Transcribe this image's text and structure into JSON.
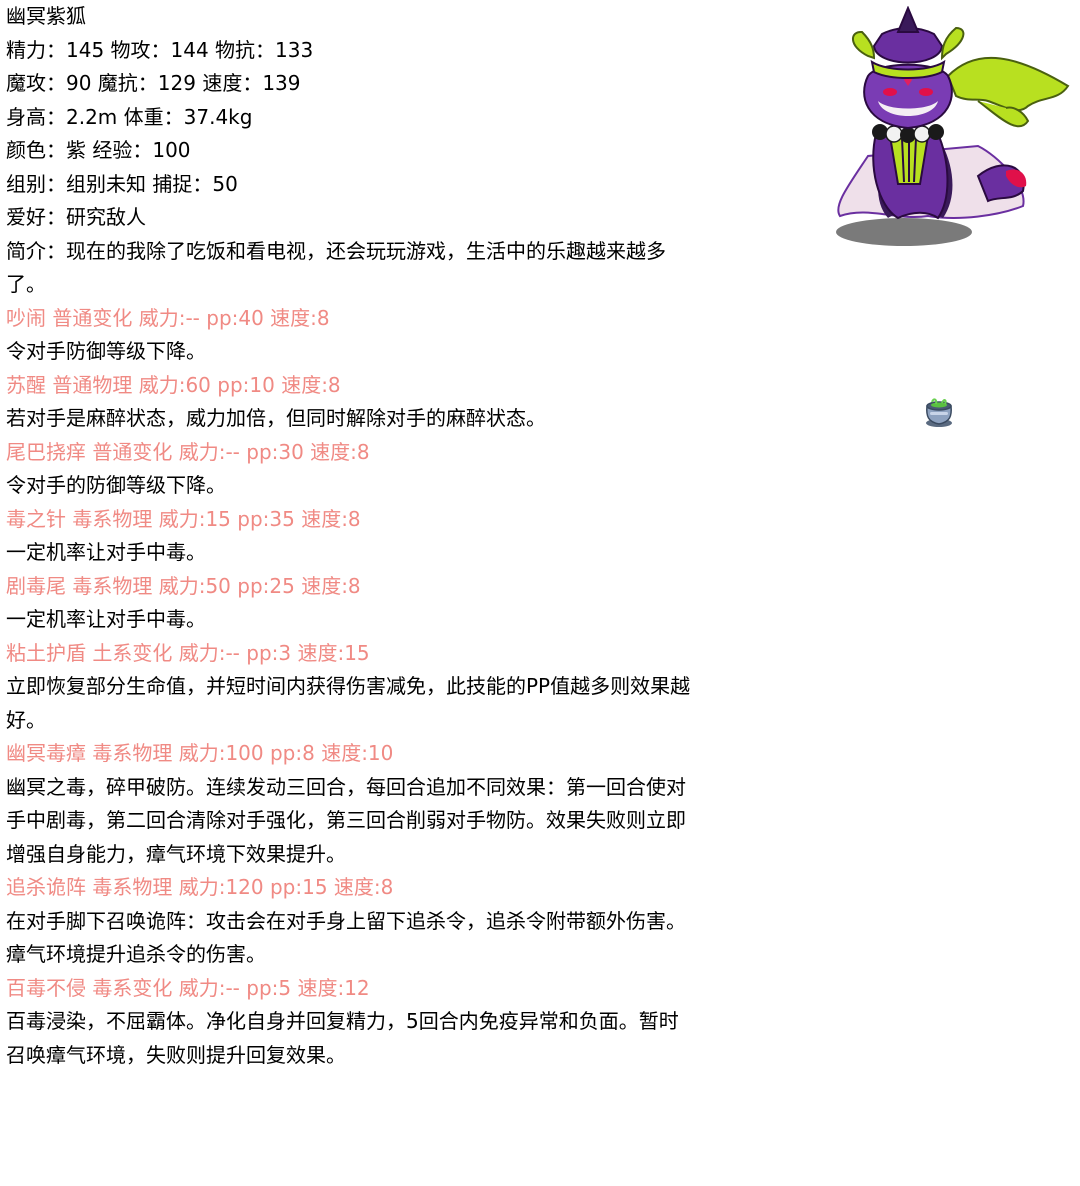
{
  "name": "幽冥紫狐",
  "stats": [
    "精力：145 物攻：144 物抗：133",
    "魔攻：90 魔抗：129 速度：139",
    "身高：2.2m 体重：37.4kg",
    "颜色：紫 经验：100",
    "组别：组别未知 捕捉：50",
    "爱好：研究敌人"
  ],
  "intro": "简介：现在的我除了吃饭和看电视，还会玩玩游戏，生活中的乐趣越来越多了。",
  "skills": [
    {
      "head": "吵闹 普通变化 威力:-- pp:40 速度:8",
      "desc": "令对手防御等级下降。"
    },
    {
      "head": "苏醒 普通物理 威力:60 pp:10 速度:8",
      "desc": "若对手是麻醉状态，威力加倍，但同时解除对手的麻醉状态。"
    },
    {
      "head": "尾巴挠痒 普通变化 威力:-- pp:30 速度:8",
      "desc": "令对手的防御等级下降。"
    },
    {
      "head": "毒之针 毒系物理 威力:15 pp:35 速度:8",
      "desc": "一定机率让对手中毒。"
    },
    {
      "head": "剧毒尾 毒系物理 威力:50 pp:25 速度:8",
      "desc": "一定机率让对手中毒。"
    },
    {
      "head": "粘土护盾 土系变化 威力:-- pp:3 速度:15",
      "desc": "立即恢复部分生命值，并短时间内获得伤害减免，此技能的PP值越多则效果越好。"
    },
    {
      "head": "幽冥毒瘴 毒系物理 威力:100 pp:8 速度:10",
      "desc": "幽冥之毒，碎甲破防。连续发动三回合，每回合追加不同效果：第一回合使对手中剧毒，第二回合清除对手强化，第三回合削弱对手物防。效果失败则立即增强自身能力，瘴气环境下效果提升。"
    },
    {
      "head": "追杀诡阵 毒系物理 威力:120 pp:15 速度:8",
      "desc": "在对手脚下召唤诡阵：攻击会在对手身上留下追杀令，追杀令附带额外伤害。瘴气环境提升追杀令的伤害。"
    },
    {
      "head": "百毒不侵 毒系变化 威力:-- pp:5 速度:12",
      "desc": "百毒浸染，不屈霸体。净化自身并回复精力，5回合内免疫异常和负面。暂时召唤瘴气环境，失败则提升回复效果。"
    }
  ],
  "colors": {
    "skill_head": "#f08a84",
    "text": "#000000",
    "creature_purple": "#6a2fa0",
    "creature_green": "#b8e020"
  },
  "icons": {
    "creature": "purple-fox-creature-image",
    "jar": "poison-jar-icon"
  }
}
